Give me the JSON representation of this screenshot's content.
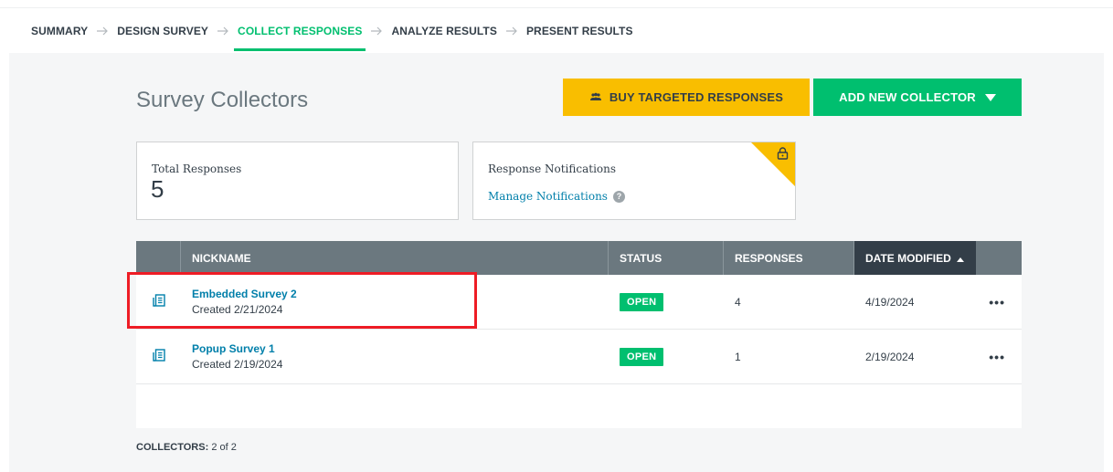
{
  "steps": [
    {
      "label": "SUMMARY",
      "active": false
    },
    {
      "label": "DESIGN SURVEY",
      "active": false
    },
    {
      "label": "COLLECT RESPONSES",
      "active": true
    },
    {
      "label": "ANALYZE RESULTS",
      "active": false
    },
    {
      "label": "PRESENT RESULTS",
      "active": false
    }
  ],
  "page": {
    "title": "Survey Collectors",
    "buy_button": "BUY TARGETED RESPONSES",
    "add_button": "ADD NEW COLLECTOR"
  },
  "total_card": {
    "label": "Total Responses",
    "value": "5"
  },
  "notif_card": {
    "label": "Response Notifications",
    "link": "Manage Notifications",
    "help": "?"
  },
  "table": {
    "headers": {
      "nickname": "NICKNAME",
      "status": "STATUS",
      "responses": "RESPONSES",
      "modified": "DATE MODIFIED"
    },
    "rows": [
      {
        "name": "Embedded Survey 2",
        "created": "Created 2/21/2024",
        "status": "OPEN",
        "responses": "4",
        "modified": "4/19/2024",
        "actions": "•••"
      },
      {
        "name": "Popup Survey 1",
        "created": "Created 2/19/2024",
        "status": "OPEN",
        "responses": "1",
        "modified": "2/19/2024",
        "actions": "•••"
      }
    ]
  },
  "footer": {
    "label": "COLLECTORS:",
    "count": "2 of 2"
  },
  "colors": {
    "accent_green": "#00bf6f",
    "accent_yellow": "#f9be00",
    "header_gray": "#6b787f",
    "header_dark": "#333e48",
    "link_blue": "#007faa",
    "highlight_red": "#ee1c25"
  }
}
